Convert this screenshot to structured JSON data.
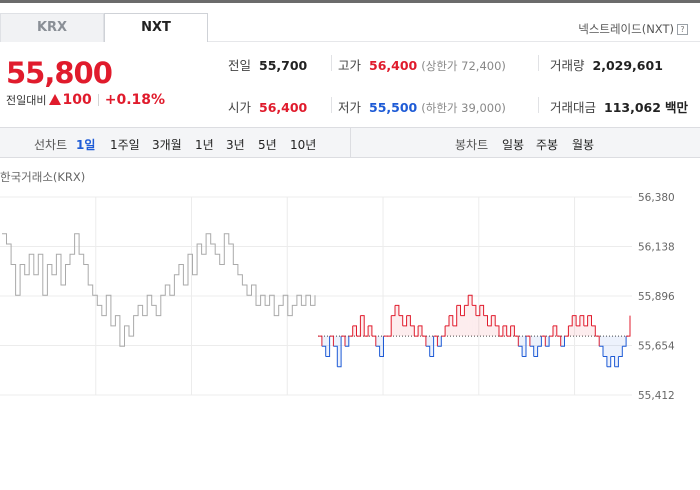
{
  "tabs": [
    {
      "label": "KRX",
      "active": false
    },
    {
      "label": "NXT",
      "active": true
    }
  ],
  "nxt_link": {
    "label": "넥스트레이드(NXT)",
    "icon": "?"
  },
  "price": {
    "current": "55,800",
    "change_label": "전일대비",
    "change_value": "100",
    "change_pct": "+0.18%",
    "direction": "up"
  },
  "stats": {
    "prev_close": {
      "label": "전일",
      "value": "55,700"
    },
    "high": {
      "label": "고가",
      "value": "56,400",
      "limit_label": "상한가",
      "limit_value": "72,400"
    },
    "volume": {
      "label": "거래량",
      "value": "2,029,601"
    },
    "open": {
      "label": "시가",
      "value": "56,400"
    },
    "low": {
      "label": "저가",
      "value": "55,500",
      "limit_label": "하한가",
      "limit_value": "39,000"
    },
    "amount": {
      "label": "거래대금",
      "value": "113,062",
      "unit": "백만"
    }
  },
  "toolbar": {
    "line_label": "선차트",
    "line_periods": [
      "1일",
      "1주일",
      "3개월",
      "1년",
      "3년",
      "5년",
      "10년"
    ],
    "line_active": "1일",
    "candle_label": "봉차트",
    "candle_periods": [
      "일봉",
      "주봉",
      "월봉"
    ]
  },
  "chart_title": "한국거래소(KRX)",
  "colors": {
    "up": "#e01b2c",
    "down": "#1e5bd6",
    "gray": "#aaaaaa"
  },
  "chart_data": {
    "type": "line",
    "y_ticks": [
      "56,380",
      "56,138",
      "55,896",
      "55,654",
      "55,412"
    ],
    "ylim": [
      55412,
      56380
    ],
    "baseline": 55700,
    "grid": true,
    "series": [
      {
        "values": [
          56200,
          56150,
          56050,
          55900,
          56050,
          56000,
          56100,
          56000,
          56100,
          55900,
          56050,
          56000,
          56100,
          55950,
          56050,
          56100,
          56200,
          56100,
          56050,
          55950,
          55900,
          55850,
          55800,
          55900,
          55750,
          55800,
          55650,
          55750,
          55700,
          55800,
          55850,
          55800,
          55900,
          55850,
          55800,
          55900,
          55950,
          55900,
          56000,
          56050,
          55950,
          56100,
          56000,
          56150,
          56100,
          56200,
          56150,
          56100,
          56050,
          56200,
          56150,
          56050,
          56000,
          55950,
          55900,
          55950,
          55850,
          55900,
          55850,
          55900,
          55800,
          55850,
          55900,
          55800,
          55850,
          55900,
          55850,
          55900,
          55850,
          55900
        ]
      },
      {
        "values": [
          55700,
          55650,
          55600,
          55700,
          55650,
          55550,
          55700,
          55650,
          55700,
          55750,
          55700,
          55800,
          55700,
          55750,
          55700,
          55650,
          55600,
          55700,
          55700,
          55800,
          55850,
          55800,
          55750,
          55800,
          55750,
          55700,
          55750,
          55700,
          55650,
          55600,
          55700,
          55650,
          55700,
          55750,
          55800,
          55750,
          55850,
          55800,
          55850,
          55900,
          55850,
          55800,
          55850,
          55800,
          55750,
          55800,
          55750,
          55700,
          55750,
          55700,
          55750,
          55700,
          55650,
          55600,
          55700,
          55650,
          55600,
          55650,
          55700,
          55650,
          55700,
          55750,
          55700,
          55650,
          55700,
          55750,
          55800,
          55750,
          55800,
          55750,
          55800,
          55750,
          55700,
          55650,
          55600,
          55550,
          55600,
          55550,
          55600,
          55650,
          55700,
          55800
        ]
      }
    ]
  }
}
